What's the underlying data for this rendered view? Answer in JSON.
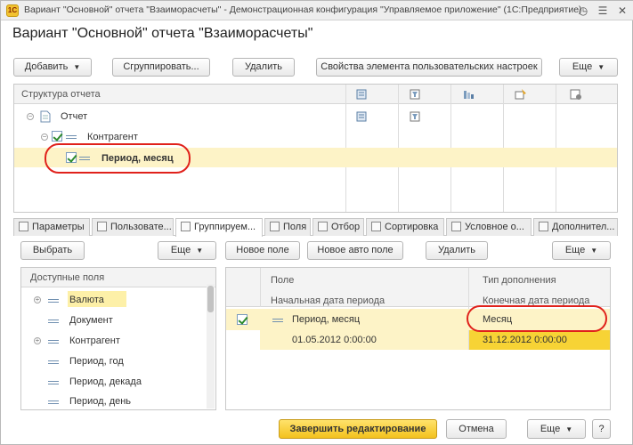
{
  "window": {
    "title": "Вариант \"Основной\" отчета \"Взаиморасчеты\" - Демонстрационная конфигурация \"Управляемое приложение\" (1С:Предприятие)",
    "app_icon": "1С"
  },
  "heading": "Вариант \"Основной\" отчета \"Взаиморасчеты\"",
  "toolbar": {
    "add": "Добавить",
    "group": "Сгруппировать...",
    "delete": "Удалить",
    "properties": "Свойства элемента пользовательских настроек",
    "more": "Еще"
  },
  "structure": {
    "header": "Структура отчета",
    "items": [
      {
        "label": "Отчет"
      },
      {
        "label": "Контрагент"
      },
      {
        "label": "Период, месяц"
      }
    ]
  },
  "tabs": [
    {
      "label": "Параметры"
    },
    {
      "label": "Пользовате..."
    },
    {
      "label": "Группируем..."
    },
    {
      "label": "Поля"
    },
    {
      "label": "Отбор"
    },
    {
      "label": "Сортировка"
    },
    {
      "label": "Условное о..."
    },
    {
      "label": "Дополнител..."
    }
  ],
  "left_toolbar": {
    "select": "Выбрать",
    "more": "Еще"
  },
  "right_toolbar": {
    "new_field": "Новое поле",
    "new_auto_field": "Новое авто поле",
    "delete": "Удалить",
    "more": "Еще"
  },
  "available_fields": {
    "header": "Доступные поля",
    "items": [
      {
        "label": "Валюта"
      },
      {
        "label": "Документ"
      },
      {
        "label": "Контрагент"
      },
      {
        "label": "Период, год"
      },
      {
        "label": "Период, декада"
      },
      {
        "label": "Период, день"
      }
    ]
  },
  "grouping_table": {
    "col_field": "Поле",
    "col_type": "Тип дополнения",
    "sub_start": "Начальная дата периода",
    "sub_end": "Конечная дата периода",
    "row": {
      "field": "Период, месяц",
      "type": "Месяц",
      "start": "01.05.2012 0:00:00",
      "end": "31.12.2012 0:00:00"
    }
  },
  "footer": {
    "finish": "Завершить редактирование",
    "cancel": "Отмена",
    "more": "Еще",
    "help": "?"
  }
}
